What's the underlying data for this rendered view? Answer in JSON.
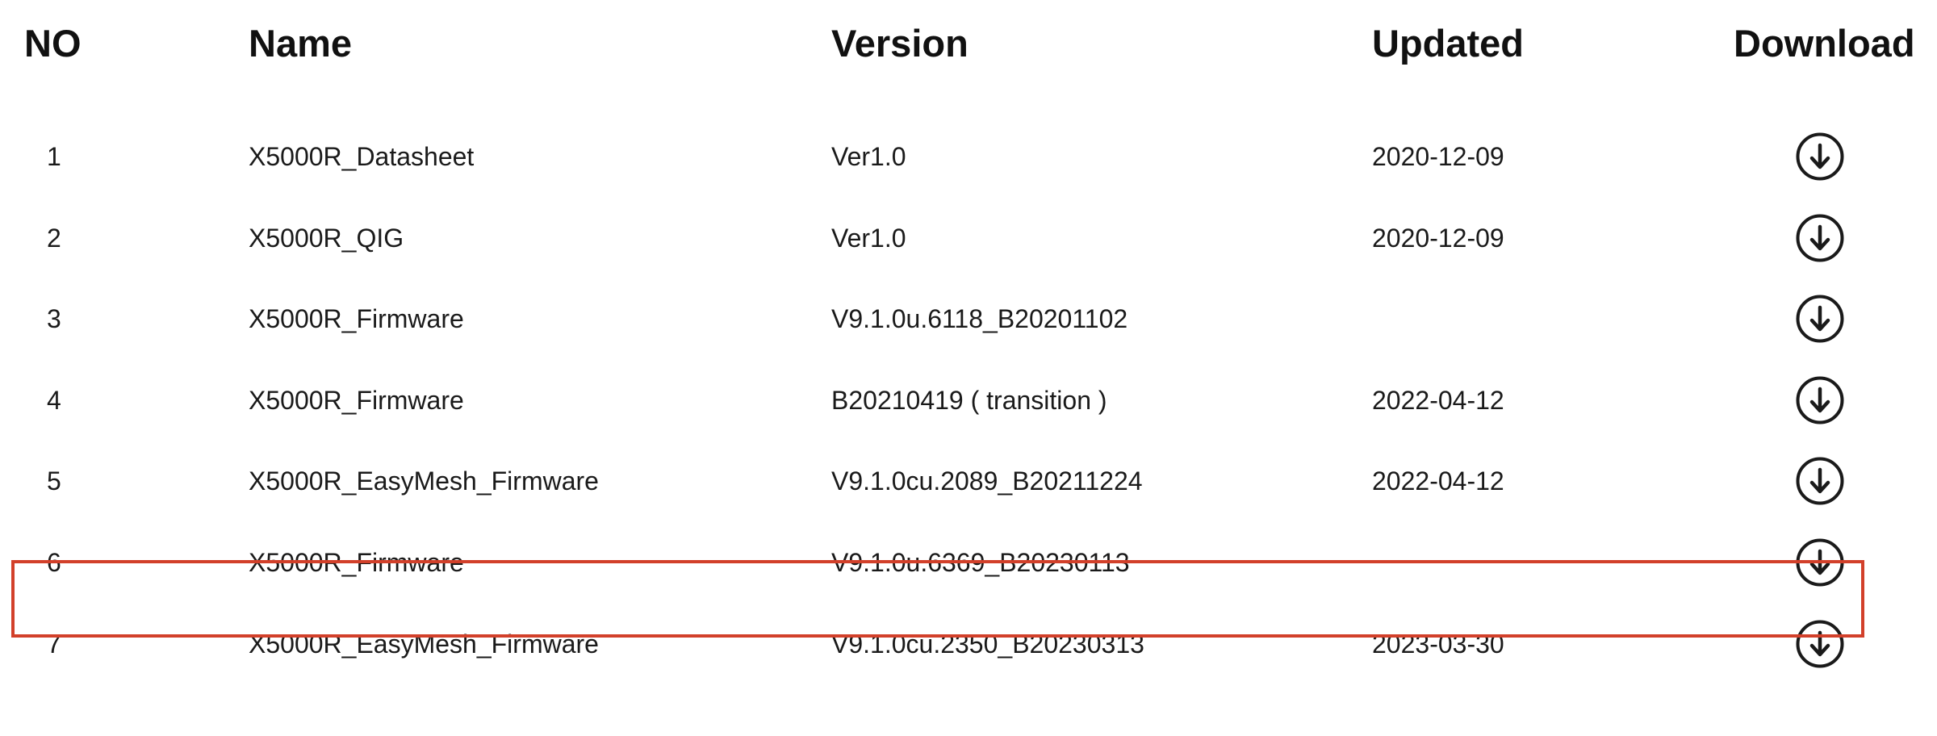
{
  "table": {
    "headers": {
      "no": "NO",
      "name": "Name",
      "version": "Version",
      "updated": "Updated",
      "download": "Download"
    },
    "rows": [
      {
        "no": "1",
        "name": "X5000R_Datasheet",
        "version": "Ver1.0",
        "updated": "2020-12-09",
        "download_icon": "download-circle-icon"
      },
      {
        "no": "2",
        "name": "X5000R_QIG",
        "version": "Ver1.0",
        "updated": "2020-12-09",
        "download_icon": "download-circle-icon"
      },
      {
        "no": "3",
        "name": "X5000R_Firmware",
        "version": "V9.1.0u.6118_B20201102",
        "updated": "",
        "download_icon": "download-circle-icon"
      },
      {
        "no": "4",
        "name": "X5000R_Firmware",
        "version": "B20210419 ( transition )",
        "updated": "2022-04-12",
        "download_icon": "download-circle-icon"
      },
      {
        "no": "5",
        "name": "X5000R_EasyMesh_Firmware",
        "version": "V9.1.0cu.2089_B20211224",
        "updated": "2022-04-12",
        "download_icon": "download-circle-icon"
      },
      {
        "no": "6",
        "name": "X5000R_Firmware",
        "version": "V9.1.0u.6369_B20230113",
        "updated": "",
        "download_icon": "download-circle-icon",
        "highlighted": true
      },
      {
        "no": "7",
        "name": "X5000R_EasyMesh_Firmware",
        "version": "V9.1.0cu.2350_B20230313",
        "updated": "2023-03-30",
        "download_icon": "download-circle-icon"
      }
    ]
  },
  "colors": {
    "text": "#1a1a1a",
    "highlight_border": "#d2402a",
    "background": "#ffffff"
  }
}
